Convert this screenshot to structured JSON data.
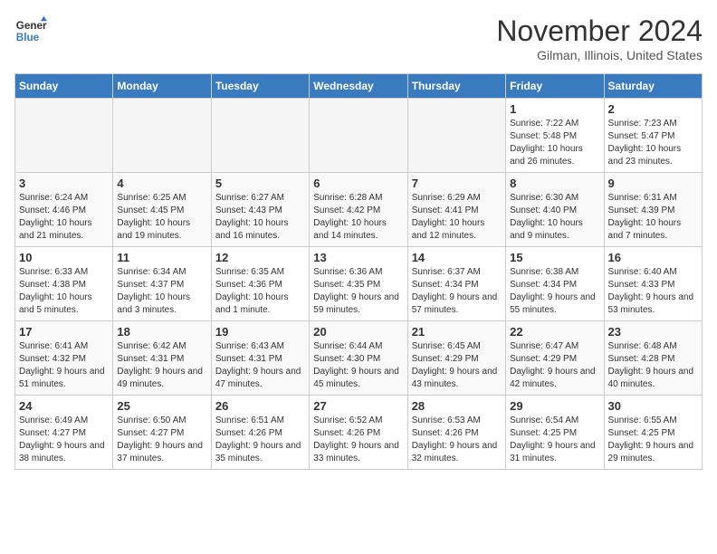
{
  "header": {
    "logo_line1": "General",
    "logo_line2": "Blue",
    "month": "November 2024",
    "location": "Gilman, Illinois, United States"
  },
  "weekdays": [
    "Sunday",
    "Monday",
    "Tuesday",
    "Wednesday",
    "Thursday",
    "Friday",
    "Saturday"
  ],
  "weeks": [
    [
      {
        "day": "",
        "info": ""
      },
      {
        "day": "",
        "info": ""
      },
      {
        "day": "",
        "info": ""
      },
      {
        "day": "",
        "info": ""
      },
      {
        "day": "",
        "info": ""
      },
      {
        "day": "1",
        "info": "Sunrise: 7:22 AM\nSunset: 5:48 PM\nDaylight: 10 hours and 26 minutes."
      },
      {
        "day": "2",
        "info": "Sunrise: 7:23 AM\nSunset: 5:47 PM\nDaylight: 10 hours and 23 minutes."
      }
    ],
    [
      {
        "day": "3",
        "info": "Sunrise: 6:24 AM\nSunset: 4:46 PM\nDaylight: 10 hours and 21 minutes."
      },
      {
        "day": "4",
        "info": "Sunrise: 6:25 AM\nSunset: 4:45 PM\nDaylight: 10 hours and 19 minutes."
      },
      {
        "day": "5",
        "info": "Sunrise: 6:27 AM\nSunset: 4:43 PM\nDaylight: 10 hours and 16 minutes."
      },
      {
        "day": "6",
        "info": "Sunrise: 6:28 AM\nSunset: 4:42 PM\nDaylight: 10 hours and 14 minutes."
      },
      {
        "day": "7",
        "info": "Sunrise: 6:29 AM\nSunset: 4:41 PM\nDaylight: 10 hours and 12 minutes."
      },
      {
        "day": "8",
        "info": "Sunrise: 6:30 AM\nSunset: 4:40 PM\nDaylight: 10 hours and 9 minutes."
      },
      {
        "day": "9",
        "info": "Sunrise: 6:31 AM\nSunset: 4:39 PM\nDaylight: 10 hours and 7 minutes."
      }
    ],
    [
      {
        "day": "10",
        "info": "Sunrise: 6:33 AM\nSunset: 4:38 PM\nDaylight: 10 hours and 5 minutes."
      },
      {
        "day": "11",
        "info": "Sunrise: 6:34 AM\nSunset: 4:37 PM\nDaylight: 10 hours and 3 minutes."
      },
      {
        "day": "12",
        "info": "Sunrise: 6:35 AM\nSunset: 4:36 PM\nDaylight: 10 hours and 1 minute."
      },
      {
        "day": "13",
        "info": "Sunrise: 6:36 AM\nSunset: 4:35 PM\nDaylight: 9 hours and 59 minutes."
      },
      {
        "day": "14",
        "info": "Sunrise: 6:37 AM\nSunset: 4:34 PM\nDaylight: 9 hours and 57 minutes."
      },
      {
        "day": "15",
        "info": "Sunrise: 6:38 AM\nSunset: 4:34 PM\nDaylight: 9 hours and 55 minutes."
      },
      {
        "day": "16",
        "info": "Sunrise: 6:40 AM\nSunset: 4:33 PM\nDaylight: 9 hours and 53 minutes."
      }
    ],
    [
      {
        "day": "17",
        "info": "Sunrise: 6:41 AM\nSunset: 4:32 PM\nDaylight: 9 hours and 51 minutes."
      },
      {
        "day": "18",
        "info": "Sunrise: 6:42 AM\nSunset: 4:31 PM\nDaylight: 9 hours and 49 minutes."
      },
      {
        "day": "19",
        "info": "Sunrise: 6:43 AM\nSunset: 4:31 PM\nDaylight: 9 hours and 47 minutes."
      },
      {
        "day": "20",
        "info": "Sunrise: 6:44 AM\nSunset: 4:30 PM\nDaylight: 9 hours and 45 minutes."
      },
      {
        "day": "21",
        "info": "Sunrise: 6:45 AM\nSunset: 4:29 PM\nDaylight: 9 hours and 43 minutes."
      },
      {
        "day": "22",
        "info": "Sunrise: 6:47 AM\nSunset: 4:29 PM\nDaylight: 9 hours and 42 minutes."
      },
      {
        "day": "23",
        "info": "Sunrise: 6:48 AM\nSunset: 4:28 PM\nDaylight: 9 hours and 40 minutes."
      }
    ],
    [
      {
        "day": "24",
        "info": "Sunrise: 6:49 AM\nSunset: 4:27 PM\nDaylight: 9 hours and 38 minutes."
      },
      {
        "day": "25",
        "info": "Sunrise: 6:50 AM\nSunset: 4:27 PM\nDaylight: 9 hours and 37 minutes."
      },
      {
        "day": "26",
        "info": "Sunrise: 6:51 AM\nSunset: 4:26 PM\nDaylight: 9 hours and 35 minutes."
      },
      {
        "day": "27",
        "info": "Sunrise: 6:52 AM\nSunset: 4:26 PM\nDaylight: 9 hours and 33 minutes."
      },
      {
        "day": "28",
        "info": "Sunrise: 6:53 AM\nSunset: 4:26 PM\nDaylight: 9 hours and 32 minutes."
      },
      {
        "day": "29",
        "info": "Sunrise: 6:54 AM\nSunset: 4:25 PM\nDaylight: 9 hours and 31 minutes."
      },
      {
        "day": "30",
        "info": "Sunrise: 6:55 AM\nSunset: 4:25 PM\nDaylight: 9 hours and 29 minutes."
      }
    ]
  ]
}
